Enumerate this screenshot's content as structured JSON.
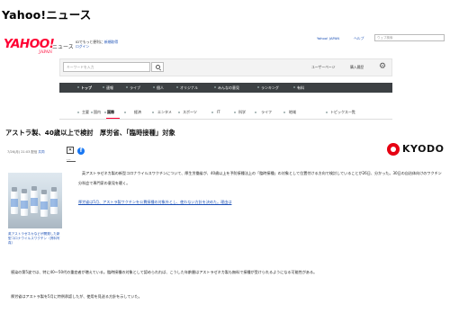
{
  "page": {
    "heading": "Yahoo!ニュース"
  },
  "masthead": {
    "logo_main": "YAHOO!",
    "logo_sub": "JAPAN",
    "service_name": "ニュース",
    "promo_line1_prefix": "IDでもっと便利に",
    "promo_line1_highlight": "新規取得",
    "promo_login": "ログイン",
    "links": [
      "Yahoo! JAPAN",
      "ヘルプ"
    ],
    "top_search_placeholder": "ウェブ検索"
  },
  "search": {
    "placeholder": "キーワードを入力",
    "links": [
      "ユーザーページ",
      "購入履歴"
    ],
    "gear_icon": "gear-icon"
  },
  "main_nav": {
    "items": [
      "トップ",
      "速報",
      "ライブ",
      "個人",
      "オリジナル",
      "みんなの意見",
      "ランキング",
      "有料"
    ],
    "active_index": 0
  },
  "category_nav": {
    "items": [
      "主要",
      "国内",
      "国際",
      "経済",
      "エンタメ",
      "スポーツ",
      "IT",
      "科学",
      "ライフ",
      "地域",
      "トピックス一覧"
    ],
    "active_index": 2,
    "accent_color": "#ff0033"
  },
  "article": {
    "title": "アストラ製、40歳以上で検討　厚労省、「臨時接種」対象",
    "meta_date": "7/26(月) 21:03 配信",
    "meta_source": "共同",
    "provider_logo_text": "KYODO",
    "provider_logo_color": "#e60012",
    "share_more_label": "...",
    "photo_caption": "英アストラゼネカなどが開発した新型コロナウイルスワクチン（資料写真）",
    "paragraph1": "英アストラゼネカ製の新型コロナウイルスワクチンについて、厚生労働省が、40歳以上を予防接種法上の「臨時接種」の対象として位置付ける方向で検討していることが26日、分かった。30日の自治体向けのワクチン分科会で専門家の意見を聴く。",
    "related_link": "厚労省は5月、アストラ製ワクチンを公費接種の対象外とし、使わない方針を決めた。理由は",
    "paragraph2": "感染の第5波では、特に40〜50代の重症者が増えている。臨時接種の対象として認められれば、こうした年齢層はアストラゼネカ製も無料で接種が受けられるようになる可能性がある。",
    "paragraph3": "厚労省はアストラ製を5月に特例承認したが、使用を見送る方針を示していた。"
  }
}
